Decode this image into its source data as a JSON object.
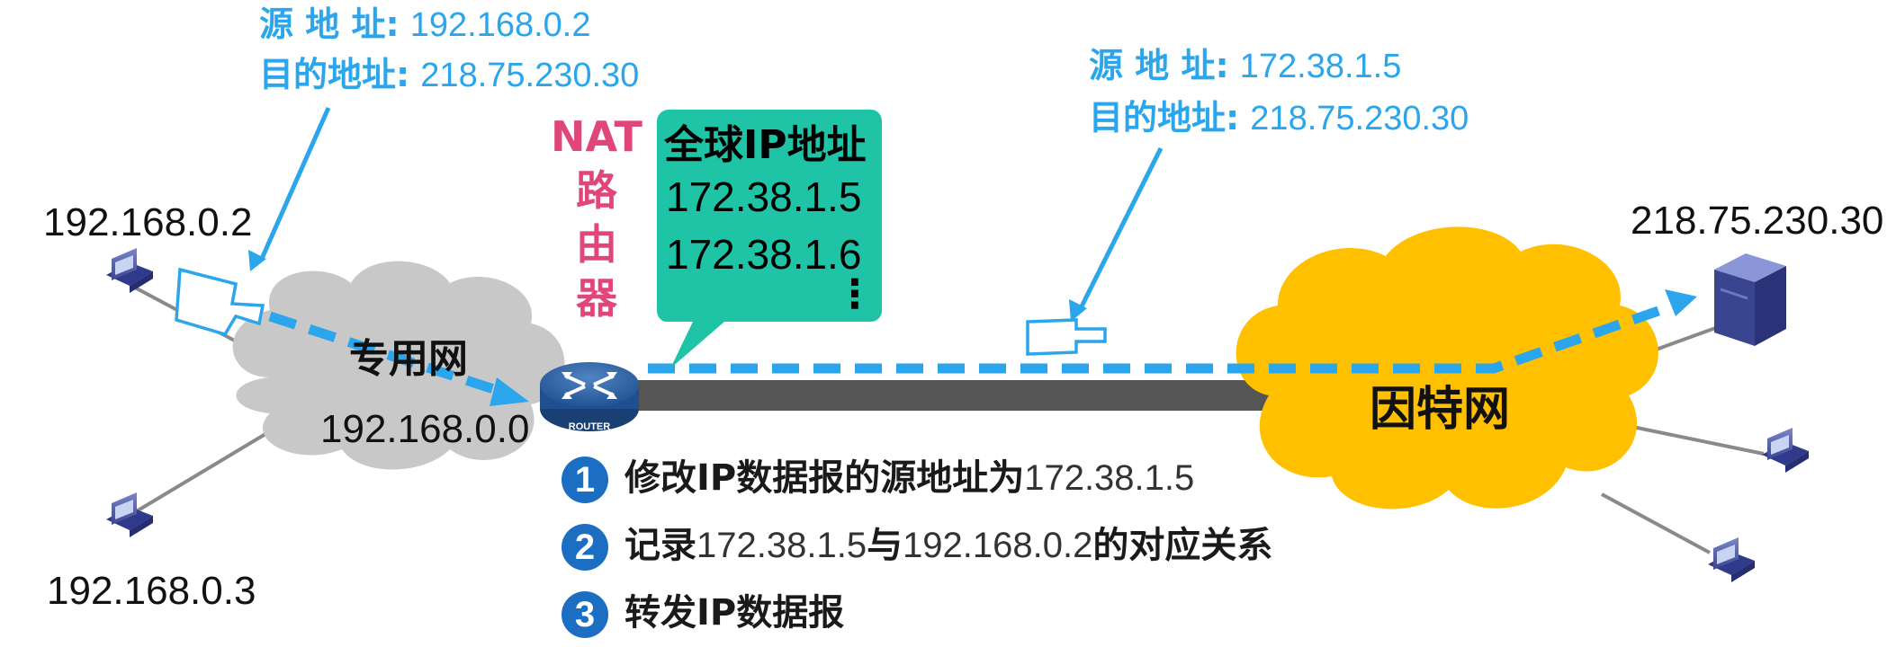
{
  "top_left_packet": {
    "src_label": "源 地 址:",
    "src_value": "192.168.0.2",
    "dst_label": "目的地址:",
    "dst_value": "218.75.230.30"
  },
  "top_right_packet": {
    "src_label": "源 地 址:",
    "src_value": "172.38.1.5",
    "dst_label": "目的地址:",
    "dst_value": "218.75.230.30"
  },
  "nat_router": {
    "label_lines": [
      "NAT",
      "路",
      "由",
      "器"
    ],
    "router_text": "ROUTER"
  },
  "global_ip_bubble": {
    "title": "全球IP地址",
    "ips": [
      "172.38.1.5",
      "172.38.1.6"
    ],
    "ellipsis": "⋮"
  },
  "hosts": {
    "host_a": "192.168.0.2",
    "host_b": "192.168.0.3",
    "server": "218.75.230.30"
  },
  "private_net": {
    "name": "专用网",
    "address": "192.168.0.0"
  },
  "internet": {
    "name": "因特网"
  },
  "steps": [
    {
      "num": "1",
      "pre": "修改IP数据报的源地址为",
      "val": "172.38.1.5",
      "post": ""
    },
    {
      "num": "2",
      "pre": "记录",
      "val": "172.38.1.5",
      "mid": "与",
      "val2": "192.168.0.2",
      "post": "的对应关系"
    },
    {
      "num": "3",
      "pre": "转发IP数据报"
    }
  ],
  "colors": {
    "accent_blue": "#2BA6EC",
    "nat_pink": "#E0457B",
    "bubble_teal": "#1FC4A6",
    "internet_yellow": "#FFC000",
    "private_gray": "#C8C8C8",
    "step_badge": "#1B6EC2"
  }
}
